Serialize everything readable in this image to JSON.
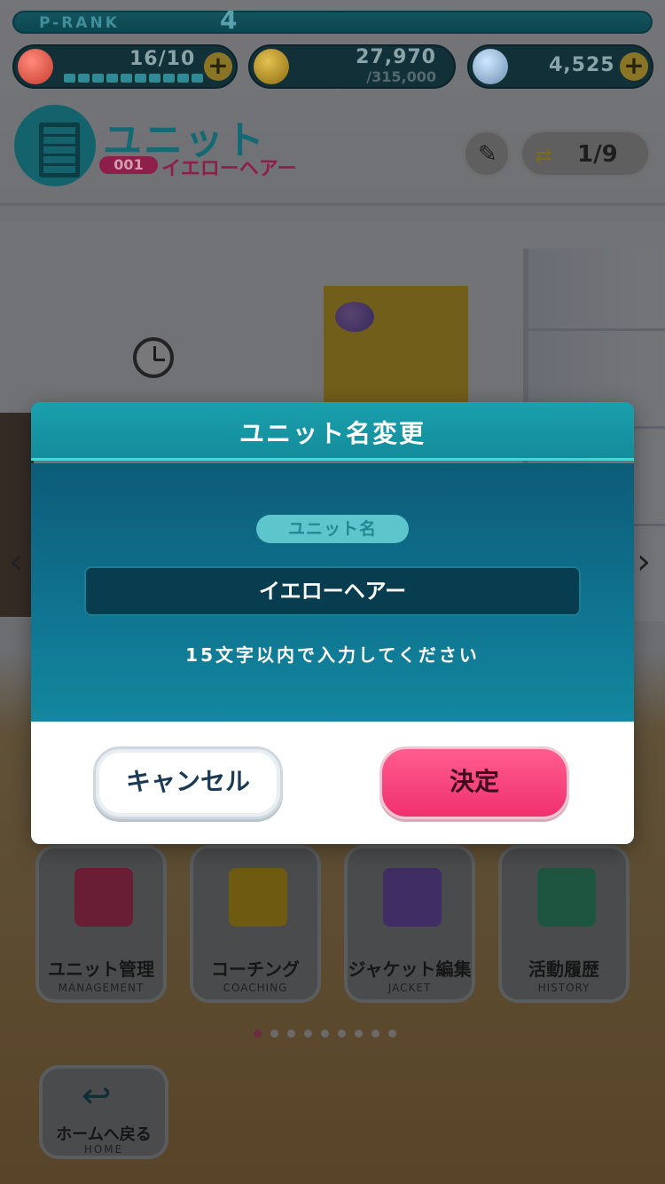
{
  "hud": {
    "rank_label": "P-RANK",
    "rank_value": "4",
    "stamina": "16/10",
    "coins": "27,970",
    "coins_max": "/315,000",
    "gems": "4,525",
    "plus": "+"
  },
  "header": {
    "title": "ユニット",
    "unit_number": "001",
    "unit_name": "イエローヘアー",
    "page": "1/9"
  },
  "menu": [
    {
      "label": "ユニット管理",
      "sub": "MANAGEMENT"
    },
    {
      "label": "コーチング",
      "sub": "COACHING"
    },
    {
      "label": "ジャケット編集",
      "sub": "JACKET"
    },
    {
      "label": "活動履歴",
      "sub": "HISTORY"
    }
  ],
  "home": {
    "label": "ホームへ戻る",
    "sub": "HOME"
  },
  "dialog": {
    "title": "ユニット名変更",
    "field_label": "ユニット名",
    "value": "イエローヘアー",
    "hint": "15文字以内で入力してください",
    "cancel": "キャンセル",
    "ok": "決定"
  },
  "colors": {
    "accent": "#148c9b",
    "confirm": "#f0306f",
    "unit_badge": "#8f1f4a"
  }
}
